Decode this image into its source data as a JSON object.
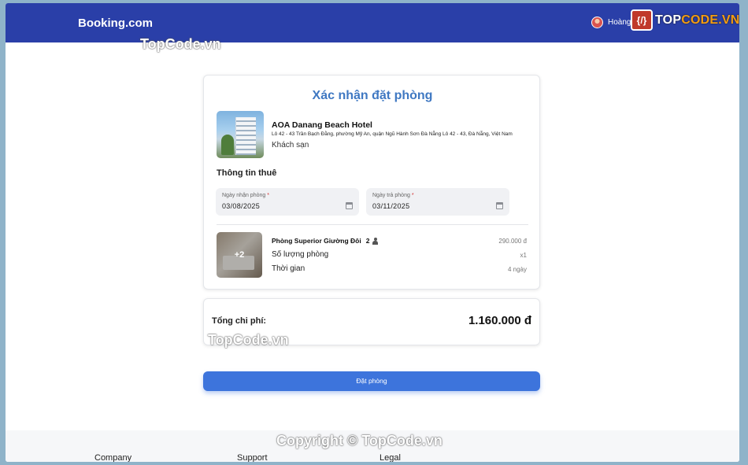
{
  "header": {
    "brand": "Booking.com",
    "user_name": "Hoàng",
    "logo_box": "{/}",
    "logo_text_main": "TOP",
    "logo_text_accent": "CODE.VN"
  },
  "booking": {
    "title": "Xác nhận đặt phòng",
    "hotel": {
      "name": "AOA Danang Beach Hotel",
      "address": "Lô 42 - 43 Trần Bạch Đằng, phường Mỹ An, quận Ngũ Hành Sơn Đà Nẵng Lô 42 - 43, Đà Nẵng, Việt Nam",
      "type": "Khách sạn"
    },
    "rental_section_title": "Thông tin thuê",
    "checkin": {
      "label": "Ngày nhận phòng",
      "required_mark": "*",
      "value": "03/08/2025"
    },
    "checkout": {
      "label": "Ngày trả phòng",
      "required_mark": "*",
      "value": "03/11/2025"
    },
    "room": {
      "image_more": "+2",
      "name": "Phòng Superior Giường Đôi",
      "guests": "2",
      "price": "290.000 đ",
      "quantity_label": "Số lượng phòng",
      "quantity_value": "x1",
      "duration_label": "Thời gian",
      "duration_value": "4 ngày"
    }
  },
  "total": {
    "label": "Tổng chi phí:",
    "value": "1.160.000 đ"
  },
  "actions": {
    "book_label": "Đặt phòng"
  },
  "footer": {
    "columns": [
      "Company",
      "Support",
      "Legal"
    ]
  },
  "watermarks": {
    "top_left": "TopCode.vn",
    "middle": "TopCode.vn",
    "bottom": "Copyright © TopCode.vn"
  },
  "colors": {
    "header_bg": "#2a3fa8",
    "title_accent": "#3f78c2",
    "button_bg": "#3d74dc",
    "required": "#d32f2f"
  }
}
